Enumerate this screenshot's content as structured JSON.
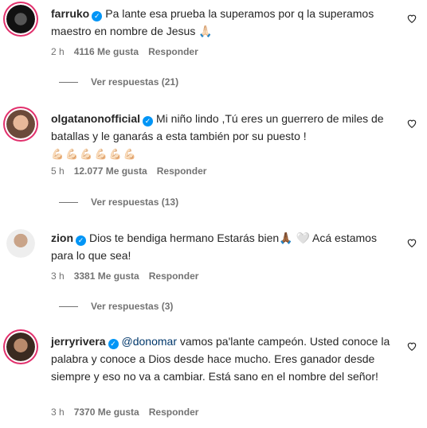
{
  "comments": [
    {
      "username": "farruko",
      "text": "Pa lante esa prueba la superamos por q la superamos maestro en nombre de Jesus 🙏🏻",
      "time": "2 h",
      "likes": "4116 Me gusta",
      "reply": "Responder",
      "view_replies": "Ver respuestas (21)"
    },
    {
      "username": "olgatanonofficial",
      "text": "Mi niño lindo ,Tú eres un guerrero de miles de batallas y le ganarás a esta también por su puesto !",
      "emojis": "💪🏻💪🏻💪🏻💪🏻💪🏻💪🏻",
      "time": "5 h",
      "likes": "12.077 Me gusta",
      "reply": "Responder",
      "view_replies": "Ver respuestas (13)"
    },
    {
      "username": "zion",
      "text": "Dios te bendiga hermano Estarás bien🙏🏾 🤍 Acá estamos para lo que sea!",
      "time": "3 h",
      "likes": "3381 Me gusta",
      "reply": "Responder",
      "view_replies": "Ver respuestas (3)"
    },
    {
      "username": "jerryrivera",
      "mention": "@donomar",
      "text": " vamos pa'lante campeón. Usted conoce la palabra y conoce a Dios desde hace mucho. Eres ganador desde siempre y eso no va a cambiar. Está sano en el nombre del señor!",
      "time": "3 h",
      "likes": "7370 Me gusta",
      "reply": "Responder"
    }
  ],
  "colors": {
    "verified": "#0095f6",
    "meta": "#737373",
    "text": "#262626",
    "mention": "#00376b"
  },
  "icons": {
    "verified": "verified-badge-icon",
    "like": "heart-outline-icon"
  }
}
